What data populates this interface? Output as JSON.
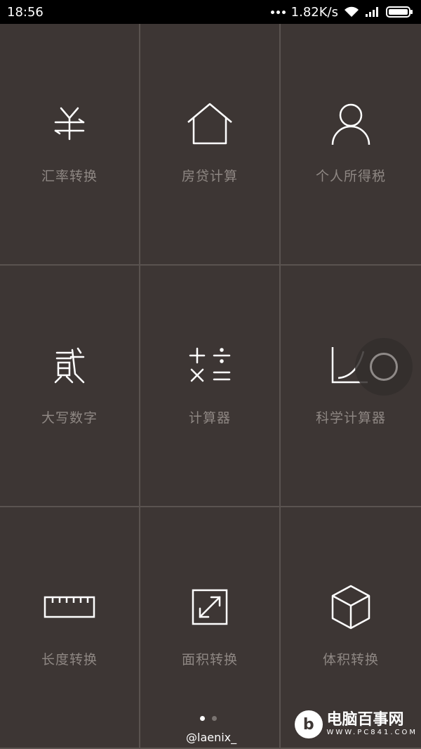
{
  "status_bar": {
    "time": "18:56",
    "speed": "1.82K/s"
  },
  "tools": [
    {
      "label": "汇率转换",
      "icon": "exchange-rate-icon"
    },
    {
      "label": "房贷计算",
      "icon": "house-icon"
    },
    {
      "label": "个人所得税",
      "icon": "person-icon"
    },
    {
      "label": "大写数字",
      "icon": "capital-number-icon"
    },
    {
      "label": "计算器",
      "icon": "calculator-icon"
    },
    {
      "label": "科学计算器",
      "icon": "scientific-graph-icon"
    },
    {
      "label": "长度转换",
      "icon": "ruler-icon"
    },
    {
      "label": "面积转换",
      "icon": "area-expand-icon"
    },
    {
      "label": "体积转换",
      "icon": "cube-icon"
    }
  ],
  "pager": {
    "current": 1,
    "total": 2
  },
  "handle": "@laenix_",
  "watermark": {
    "title": "电脑百事网",
    "url": "WWW.PC841.COM"
  },
  "colors": {
    "background": "#3d3634",
    "label": "#8e8783",
    "divider": "#5a5350",
    "icon": "#ffffff"
  }
}
